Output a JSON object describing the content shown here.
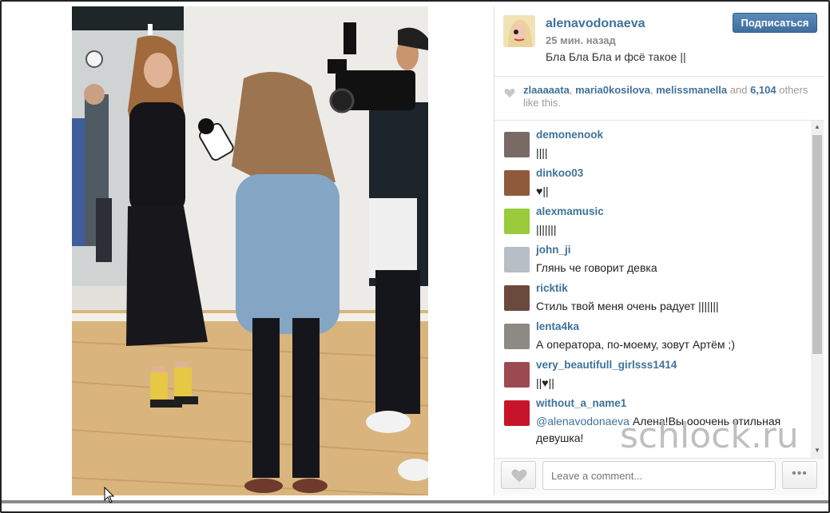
{
  "post": {
    "username": "alenavodonaeva",
    "time_ago": "25 мин. назад",
    "caption": "Бла Бла Бла и фсё такое ||",
    "follow_label": "Подписаться"
  },
  "likes": {
    "users": [
      "zlaaaaata",
      "maria0kosilova",
      "melissmanella"
    ],
    "sep1": ", ",
    "sep2": ", ",
    "and_text": " and ",
    "count": "6,104",
    "suffix": " others like this."
  },
  "comments": [
    {
      "user": "demonenook",
      "text": "||||",
      "avatar_color": "#7a6a66"
    },
    {
      "user": "dinkoo03",
      "text": "♥||",
      "avatar_color": "#8f5a3c"
    },
    {
      "user": "alexmamusic",
      "text": "|||||||",
      "avatar_color": "#9acb3a"
    },
    {
      "user": "john_ji",
      "text": "Глянь че говорит девка",
      "avatar_color": "#b8bec6"
    },
    {
      "user": "ricktik",
      "text": "Стиль твой меня очень радует |||||||",
      "avatar_color": "#6b4a3e"
    },
    {
      "user": "lenta4ka",
      "text": "А оператора, по-моему, зовут Артём ;)",
      "avatar_color": "#8d8a84"
    },
    {
      "user": "very_beautifull_girlsss1414",
      "text": "||♥||",
      "avatar_color": "#9c4a52"
    },
    {
      "user": "without_a_name1",
      "mention": "@alenavodonaeva",
      "text": " Алена!Вы ооочень отильная девушка!",
      "avatar_color": "#c8142a"
    }
  ],
  "footer": {
    "comment_placeholder": "Leave a comment...",
    "more_label": "•••"
  },
  "watermark": "schlock.ru",
  "colors": {
    "link_blue": "#3f729b",
    "follow_button": "#4a7bab"
  }
}
